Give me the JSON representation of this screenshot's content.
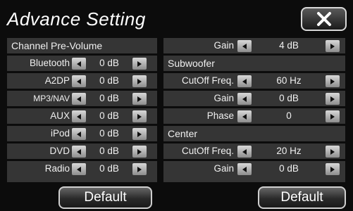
{
  "title": "Advance Setting",
  "close_icon": "close-x-icon",
  "left_panel": {
    "header": "Channel Pre-Volume",
    "rows": [
      {
        "label": "Bluetooth",
        "value": "0 dB"
      },
      {
        "label": "A2DP",
        "value": "0 dB"
      },
      {
        "label": "MP3/NAV",
        "value": "0 dB"
      },
      {
        "label": "AUX",
        "value": "0 dB"
      },
      {
        "label": "iPod",
        "value": "0 dB"
      },
      {
        "label": "DVD",
        "value": "0 dB"
      },
      {
        "label": "Radio",
        "value": "0 dB"
      }
    ]
  },
  "right_panel": {
    "top_gain": {
      "label": "Gain",
      "value": "4 dB"
    },
    "subwoofer": {
      "header": "Subwoofer",
      "rows": [
        {
          "label": "CutOff Freq.",
          "value": "60 Hz"
        },
        {
          "label": "Gain",
          "value": "0 dB"
        },
        {
          "label": "Phase",
          "value": "0"
        }
      ]
    },
    "center": {
      "header": "Center",
      "rows": [
        {
          "label": "CutOff Freq.",
          "value": "20 Hz"
        },
        {
          "label": "Gain",
          "value": "0 dB"
        }
      ]
    }
  },
  "buttons": {
    "default_left": "Default",
    "default_right": "Default"
  }
}
